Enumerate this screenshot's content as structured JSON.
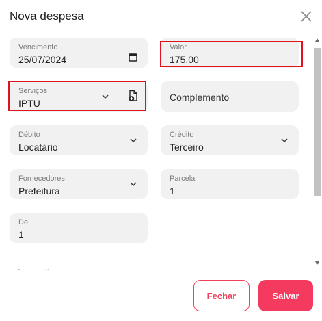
{
  "dialog": {
    "title": "Nova despesa",
    "close_icon": "close-icon"
  },
  "form": {
    "vencimento": {
      "label": "Vencimento",
      "value": "25/07/2024",
      "icon": "calendar-icon"
    },
    "valor": {
      "label": "Valor",
      "value": "175,00"
    },
    "servicos": {
      "label": "Serviços",
      "value": "IPTU",
      "icon": "add-document-icon"
    },
    "complemento": {
      "placeholder": "Complemento"
    },
    "debito": {
      "label": "Débito",
      "value": "Locatário"
    },
    "credito": {
      "label": "Crédito",
      "value": "Terceiro"
    },
    "fornecedores": {
      "label": "Fornecedores",
      "value": "Prefeitura"
    },
    "parcela": {
      "label": "Parcela",
      "value": "1"
    },
    "de": {
      "label": "De",
      "value": "1"
    },
    "next_section_partial": "Informações"
  },
  "footer": {
    "close_label": "Fechar",
    "save_label": "Salvar"
  },
  "colors": {
    "highlight": "#e0121e",
    "accent": "#f53a5f",
    "field_bg": "#f1f1f1"
  }
}
